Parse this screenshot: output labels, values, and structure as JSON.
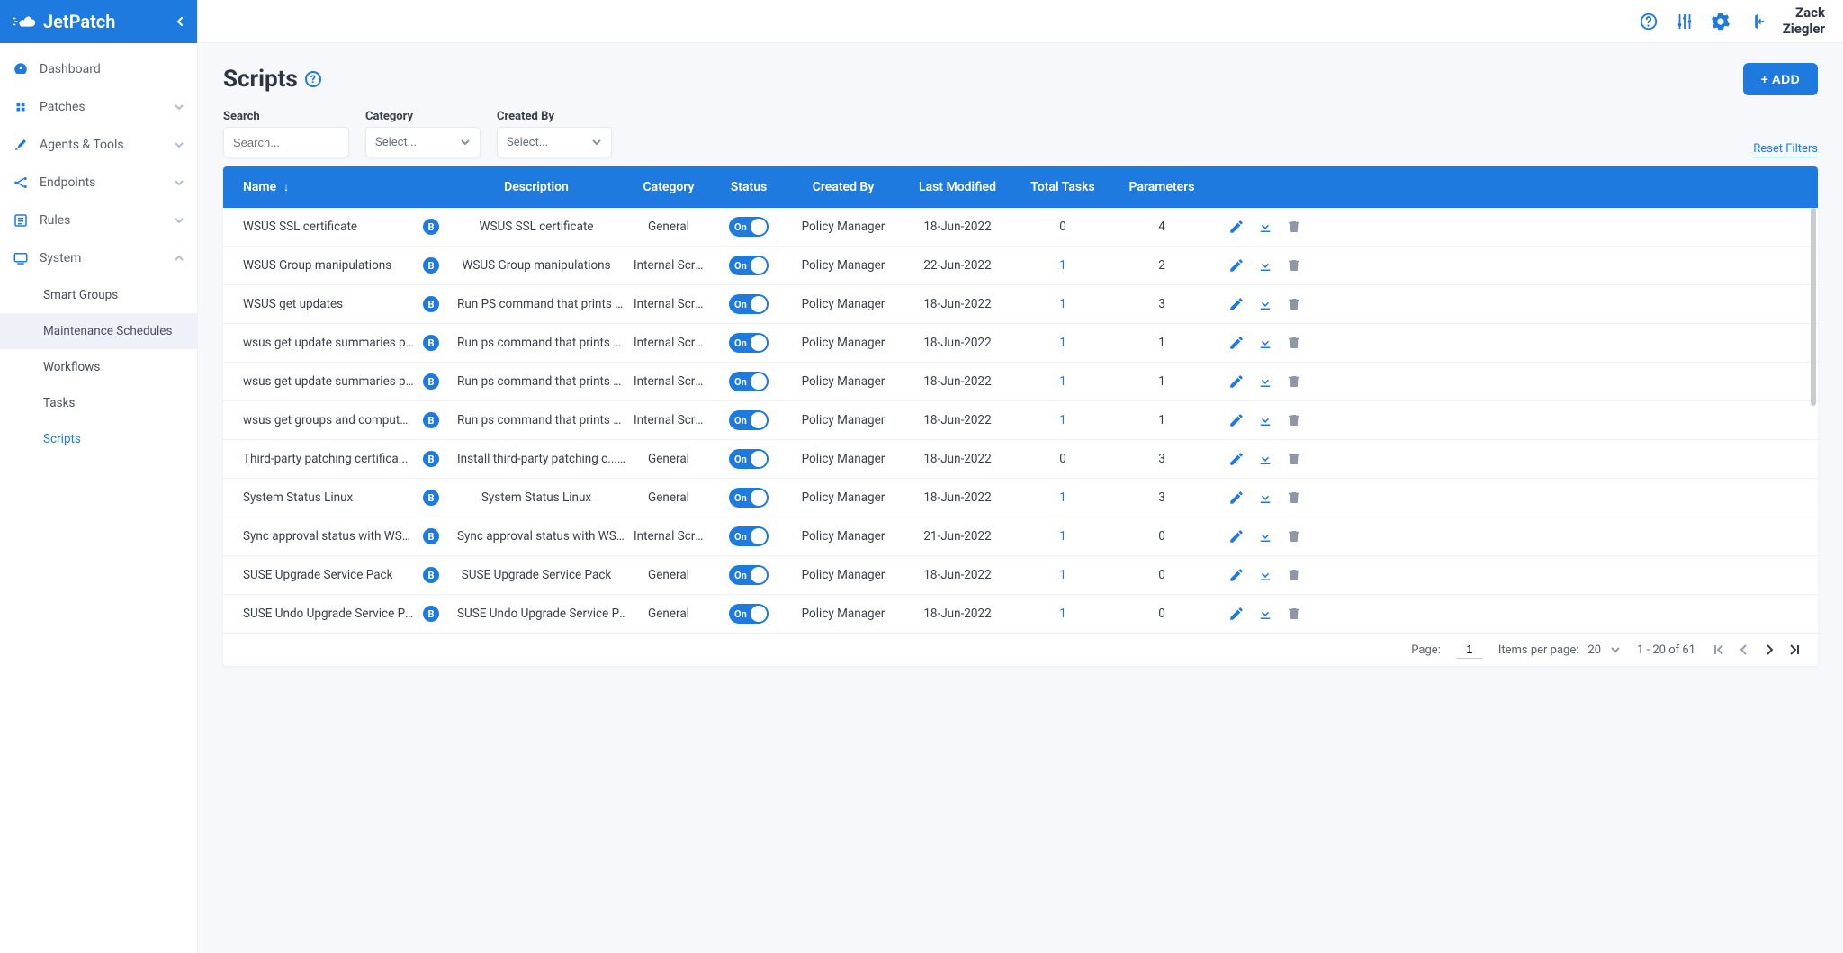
{
  "brand": {
    "name": "JetPatch"
  },
  "user": {
    "first": "Zack",
    "last": "Ziegler"
  },
  "nav": {
    "dashboard": "Dashboard",
    "patches": "Patches",
    "agents": "Agents & Tools",
    "endpoints": "Endpoints",
    "rules": "Rules",
    "system": "System",
    "system_items": {
      "smart_groups": "Smart Groups",
      "maint": "Maintenance Schedules",
      "workflows": "Workflows",
      "tasks": "Tasks",
      "scripts": "Scripts"
    }
  },
  "page": {
    "title": "Scripts",
    "add_button": "+ ADD",
    "reset_filters": "Reset Filters",
    "filters": {
      "search_label": "Search",
      "search_placeholder": "Search...",
      "category_label": "Category",
      "category_placeholder": "Select...",
      "createdby_label": "Created By",
      "createdby_placeholder": "Select..."
    }
  },
  "table": {
    "headers": {
      "name": "Name",
      "description": "Description",
      "category": "Category",
      "status": "Status",
      "created_by": "Created By",
      "last_modified": "Last Modified",
      "total_tasks": "Total Tasks",
      "parameters": "Parameters"
    },
    "toggle_on_label": "On",
    "rows": [
      {
        "name": "WSUS SSL certificate",
        "desc": "WSUS SSL certificate",
        "cat": "General",
        "cb": "Policy Manager",
        "lm": "18-Jun-2022",
        "tt": "0",
        "tt_link": false,
        "pm": "4"
      },
      {
        "name": "WSUS Group manipulations",
        "desc": "WSUS Group manipulations",
        "cat": "Internal Script",
        "cb": "Policy Manager",
        "lm": "22-Jun-2022",
        "tt": "1",
        "tt_link": true,
        "pm": "2"
      },
      {
        "name": "WSUS get updates",
        "desc": "Run PS command that prints WSU...",
        "cat": "Internal Script",
        "cb": "Policy Manager",
        "lm": "18-Jun-2022",
        "tt": "1",
        "tt_link": true,
        "pm": "3"
      },
      {
        "name": "wsus get update summaries per ...",
        "desc": "Run ps command that prints WSU...",
        "cat": "Internal Script",
        "cb": "Policy Manager",
        "lm": "18-Jun-2022",
        "tt": "1",
        "tt_link": true,
        "pm": "1"
      },
      {
        "name": "wsus get update summaries per ...",
        "desc": "Run ps command that prints WSU...",
        "cat": "Internal Script",
        "cb": "Policy Manager",
        "lm": "18-Jun-2022",
        "tt": "1",
        "tt_link": true,
        "pm": "1"
      },
      {
        "name": "wsus get groups and computers ...",
        "desc": "Run ps command that prints WSU...",
        "cat": "Internal Script",
        "cb": "Policy Manager",
        "lm": "18-Jun-2022",
        "tt": "1",
        "tt_link": true,
        "pm": "1"
      },
      {
        "name": "Third-party patching certifica...",
        "desc": "Install third-party patching c...",
        "cat": "General",
        "cb": "Policy Manager",
        "lm": "18-Jun-2022",
        "tt": "0",
        "tt_link": false,
        "pm": "3"
      },
      {
        "name": "System Status Linux",
        "desc": "System Status Linux",
        "cat": "General",
        "cb": "Policy Manager",
        "lm": "18-Jun-2022",
        "tt": "1",
        "tt_link": true,
        "pm": "3"
      },
      {
        "name": "Sync approval status with WSUS",
        "desc": "Sync approval status with WSUS",
        "cat": "Internal Script",
        "cb": "Policy Manager",
        "lm": "21-Jun-2022",
        "tt": "1",
        "tt_link": true,
        "pm": "0"
      },
      {
        "name": "SUSE Upgrade Service Pack",
        "desc": "SUSE Upgrade Service Pack",
        "cat": "General",
        "cb": "Policy Manager",
        "lm": "18-Jun-2022",
        "tt": "1",
        "tt_link": true,
        "pm": "0"
      },
      {
        "name": "SUSE Undo Upgrade Service Pack",
        "desc": "SUSE Undo Upgrade Service Pack",
        "cat": "General",
        "cb": "Policy Manager",
        "lm": "18-Jun-2022",
        "tt": "1",
        "tt_link": true,
        "pm": "0"
      }
    ]
  },
  "pagination": {
    "page_label": "Page:",
    "page_value": "1",
    "ipp_label": "Items per page:",
    "ipp_value": "20",
    "range": "1 - 20 of 61"
  }
}
